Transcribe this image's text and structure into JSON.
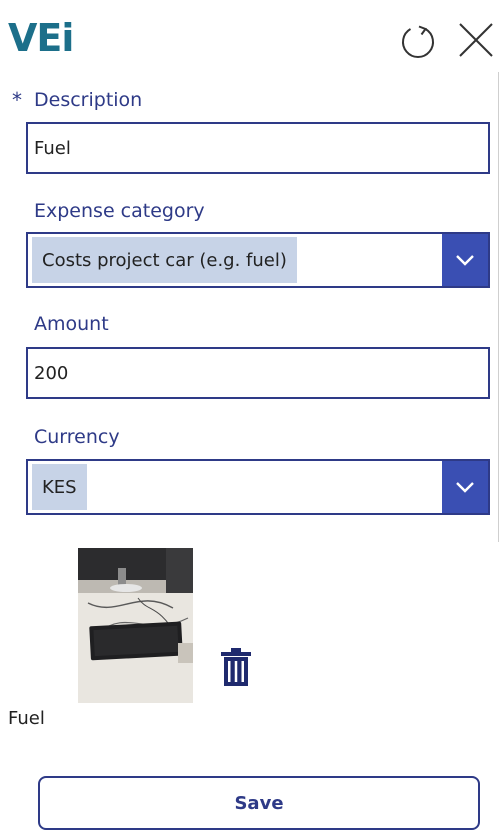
{
  "header": {
    "logo_text": "VEi",
    "refresh_icon": "refresh-icon",
    "close_icon": "close-icon"
  },
  "form": {
    "required_marker": "*",
    "description": {
      "label": "Description",
      "value": "Fuel"
    },
    "expense_category": {
      "label": "Expense category",
      "selected": "Costs project car (e.g. fuel)"
    },
    "amount": {
      "label": "Amount",
      "value": "200"
    },
    "currency": {
      "label": "Currency",
      "selected": "KES"
    }
  },
  "attachment": {
    "caption": "Fuel",
    "delete_icon": "trash-icon"
  },
  "actions": {
    "save_label": "Save"
  },
  "colors": {
    "brand": "#1c6f8a",
    "accent": "#2e3a87",
    "dropdown_button": "#3a4fb3",
    "selection_highlight": "#c7d3e7"
  }
}
